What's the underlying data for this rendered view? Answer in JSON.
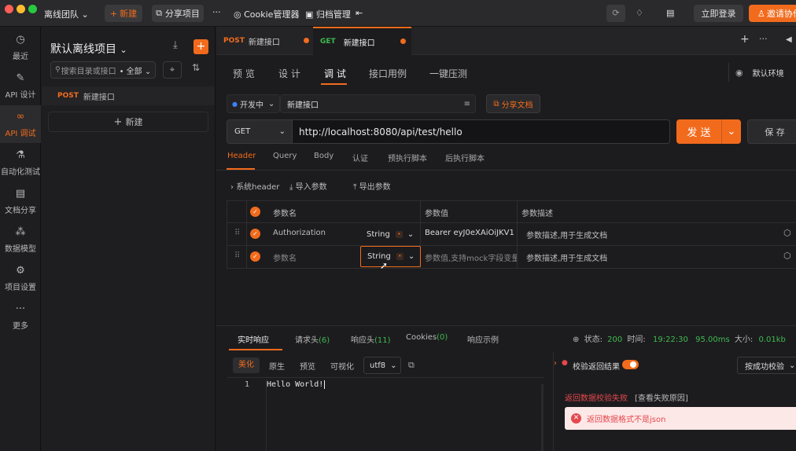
{
  "colors": {
    "accent": "#f26b1d",
    "post": "#f26b1d",
    "get": "#3fb950",
    "error": "#e5484d"
  },
  "topbar": {
    "team": "离线团队",
    "new_btn": "新建",
    "share_btn": "分享项目",
    "more": "···",
    "cookie": "Cookie管理器",
    "archive": "归档管理",
    "login": "立即登录",
    "invite": "邀请协作"
  },
  "nav": [
    {
      "label": "最近",
      "icon": "clock-icon"
    },
    {
      "label": "API 设计",
      "icon": "design-icon"
    },
    {
      "label": "API 调试",
      "icon": "debug-icon"
    },
    {
      "label": "自动化测试",
      "icon": "test-icon"
    },
    {
      "label": "文档分享",
      "icon": "doc-icon"
    },
    {
      "label": "数据模型",
      "icon": "model-icon"
    },
    {
      "label": "项目设置",
      "icon": "settings-icon"
    },
    {
      "label": "更多",
      "icon": "more-icon"
    }
  ],
  "tree": {
    "project": "默认离线项目",
    "search_placeholder": "搜索目录或接口",
    "filter": "全部",
    "item_method": "POST",
    "item_name": "新建接口",
    "new_btn": "新建"
  },
  "tabs": [
    {
      "method": "POST",
      "name": "新建接口"
    },
    {
      "method": "GET",
      "name": "新建接口"
    }
  ],
  "subtabs": [
    "预 览",
    "设 计",
    "调 试",
    "接口用例",
    "一键压测"
  ],
  "env": "默认环境",
  "server": "开发中",
  "api_name": "新建接口",
  "share_doc": "分享文档",
  "request": {
    "method": "GET",
    "url": "http://localhost:8080/api/test/hello",
    "send": "发 送",
    "save": "保 存"
  },
  "req_tabs": [
    "Header",
    "Query",
    "Body",
    "认证",
    "预执行脚本",
    "后执行脚本"
  ],
  "header_tools": {
    "sys": "系统header",
    "import": "导入参数",
    "export": "导出参数"
  },
  "params": {
    "columns": [
      "参数名",
      "参数值",
      "参数描述"
    ],
    "rows": [
      {
        "name": "Authorization",
        "type": "String",
        "value": "Bearer eyJ0eXAiOiJKV1",
        "desc": "参数描述,用于生成文档"
      },
      {
        "name": "参数名",
        "type": "String",
        "value": "参数值,支持mock字段变量",
        "desc": "参数描述,用于生成文档"
      }
    ]
  },
  "resp_tabs": [
    {
      "label": "实时响应",
      "count": ""
    },
    {
      "label": "请求头",
      "count": "(6)"
    },
    {
      "label": "响应头",
      "count": "(11)"
    },
    {
      "label": "Cookies",
      "count": "(0)"
    },
    {
      "label": "响应示例",
      "count": ""
    }
  ],
  "status": {
    "status_label": "状态:",
    "code": "200",
    "time_label": "时间:",
    "time": "19:22:30",
    "duration": "95.00ms",
    "size_label": "大小:",
    "size": "0.01kb"
  },
  "view_modes": [
    "美化",
    "原生",
    "预览",
    "可视化"
  ],
  "encoding": "utf8",
  "code": {
    "line": "1",
    "text": "Hello World!"
  },
  "validation": {
    "label": "校验返回结果",
    "mode": "按成功校验",
    "fail": "返回数据校验失败",
    "reason": "[查看失败原因]",
    "error": "返回数据格式不是json"
  }
}
